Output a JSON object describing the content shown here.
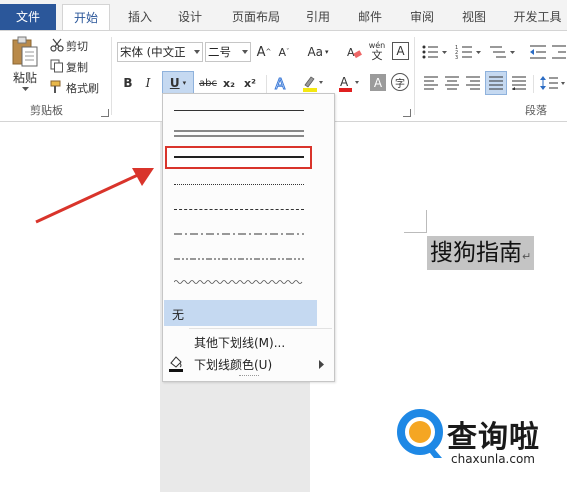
{
  "tabs": [
    {
      "label": "文件"
    },
    {
      "label": "开始"
    },
    {
      "label": "插入"
    },
    {
      "label": "设计"
    },
    {
      "label": "页面布局"
    },
    {
      "label": "引用"
    },
    {
      "label": "邮件"
    },
    {
      "label": "审阅"
    },
    {
      "label": "视图"
    },
    {
      "label": "开发工具"
    }
  ],
  "clipboard": {
    "paste": "粘贴",
    "cut": "剪切",
    "copy": "复制",
    "format_painter": "格式刷",
    "group_label": "剪贴板"
  },
  "font": {
    "font_name": "宋体 (中文正",
    "font_size": "二号",
    "grow": "A",
    "shrink": "A",
    "change_case": "Aa",
    "phonetic": "wén",
    "bold": "B",
    "italic": "I",
    "underline": "U",
    "strike": "abc",
    "subscript": "x₂",
    "superscript": "x²",
    "char_border": "A",
    "char_shading": "A",
    "enclose": "字"
  },
  "paragraph": {
    "group_label": "段落"
  },
  "underline_menu": {
    "none_label": "无",
    "more_label": "其他下划线(M)...",
    "color_label": "下划线颜色(U)",
    "selected_style": "thick"
  },
  "document": {
    "text": "搜狗指南",
    "para_mark": "↵"
  },
  "watermark": {
    "name": "查询啦",
    "url": "chaxunla.com"
  },
  "colors": {
    "accent": "#2b579a",
    "highlight_box": "#d9342b",
    "arrow": "#d9342b",
    "selected_item": "#c5d9f1",
    "watermark_blue": "#1e88e5",
    "watermark_orange": "#f5a623"
  }
}
